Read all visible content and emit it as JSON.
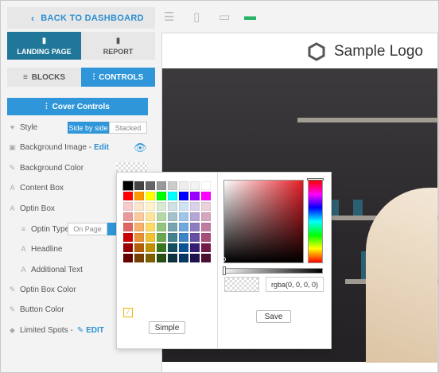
{
  "sidebar": {
    "back_label": "BACK TO DASHBOARD",
    "tabs": [
      {
        "label": "LANDING PAGE"
      },
      {
        "label": "REPORT"
      }
    ],
    "subtabs": [
      {
        "label": "BLOCKS"
      },
      {
        "label": "CONTROLS"
      }
    ],
    "cover_controls": "Cover Controls",
    "style_label": "Style",
    "style_options": [
      "Side by side",
      "Stacked"
    ],
    "background_image": "Background Image -",
    "edit": "Edit",
    "background_color": "Background Color",
    "content_box": "Content Box",
    "optin_box": "Optin Box",
    "optin_type": "Optin Type",
    "optin_type_value": "On Page",
    "headline": "Headline",
    "additional_text": "Additional Text",
    "optin_box_color": "Optin Box Color",
    "button_color": "Button Color",
    "limited_spots": "Limited Spots -",
    "edit_caps": "EDIT"
  },
  "preview": {
    "logo_text": "Sample Logo"
  },
  "color_picker": {
    "simple_button": "Simple",
    "save_button": "Save",
    "rgba_value": "rgba(0, 0, 0, 0)",
    "swatches": [
      "#000000",
      "#444444",
      "#666666",
      "#999999",
      "#cccccc",
      "#eeeeee",
      "#f3f3f3",
      "#ffffff",
      "#ff0000",
      "#ff9900",
      "#ffff00",
      "#00ff00",
      "#00ffff",
      "#0000ff",
      "#9900ff",
      "#ff00ff",
      "#f4cccc",
      "#fce5cd",
      "#fff2cc",
      "#d9ead3",
      "#d0e0e3",
      "#cfe2f3",
      "#d9d2e9",
      "#ead1dc",
      "#ea9999",
      "#f9cb9c",
      "#ffe599",
      "#b6d7a8",
      "#a2c4c9",
      "#9fc5e8",
      "#b4a7d6",
      "#d5a6bd",
      "#e06666",
      "#f6b26b",
      "#ffd966",
      "#93c47d",
      "#76a5af",
      "#6fa8dc",
      "#8e7cc3",
      "#c27ba0",
      "#cc0000",
      "#e69138",
      "#f1c232",
      "#6aa84f",
      "#45818e",
      "#3d85c6",
      "#674ea7",
      "#a64d79",
      "#990000",
      "#b45f06",
      "#bf9000",
      "#38761d",
      "#134f5c",
      "#0b5394",
      "#351c75",
      "#741b47",
      "#660000",
      "#783f04",
      "#7f6000",
      "#274e13",
      "#0c343d",
      "#073763",
      "#20124d",
      "#4c1130"
    ]
  }
}
